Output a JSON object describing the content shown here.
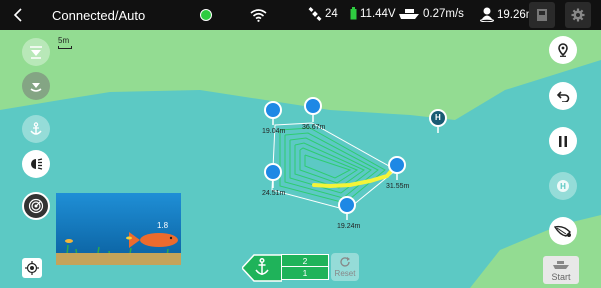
{
  "header": {
    "mode": "Connected/Auto",
    "satellites": "24",
    "voltage": "11.44V",
    "speed": "0.27m/s",
    "distance": "19.26m"
  },
  "colors": {
    "topbar": "#111111",
    "water": "#5cc9c4",
    "land": "#93dc92",
    "status_green": "#2ecc40",
    "waypoint_blue": "#1e88e5",
    "route_green": "#2ecc71",
    "track_yellow": "#f4f43a"
  },
  "map": {
    "scale_label": "5m",
    "waypoint_labels": [
      "19.04m",
      "36.67m",
      "24.51m",
      "31.55m",
      "19.24m"
    ],
    "home_marker_letter": "H"
  },
  "sonar": {
    "depth_label": "1.8"
  },
  "bottom": {
    "counter_top": "2",
    "counter_bottom": "1",
    "reset_label": "Reset",
    "start_label": "Start"
  },
  "icons": {
    "left": [
      "return-home-icon",
      "bait-drop-icon",
      "anchor-icon",
      "light-icon",
      "sonar-icon",
      "locate-icon"
    ],
    "right": [
      "location-pin-icon",
      "undo-icon",
      "pause-icon",
      "home-icon",
      "route-shape-icon"
    ]
  }
}
